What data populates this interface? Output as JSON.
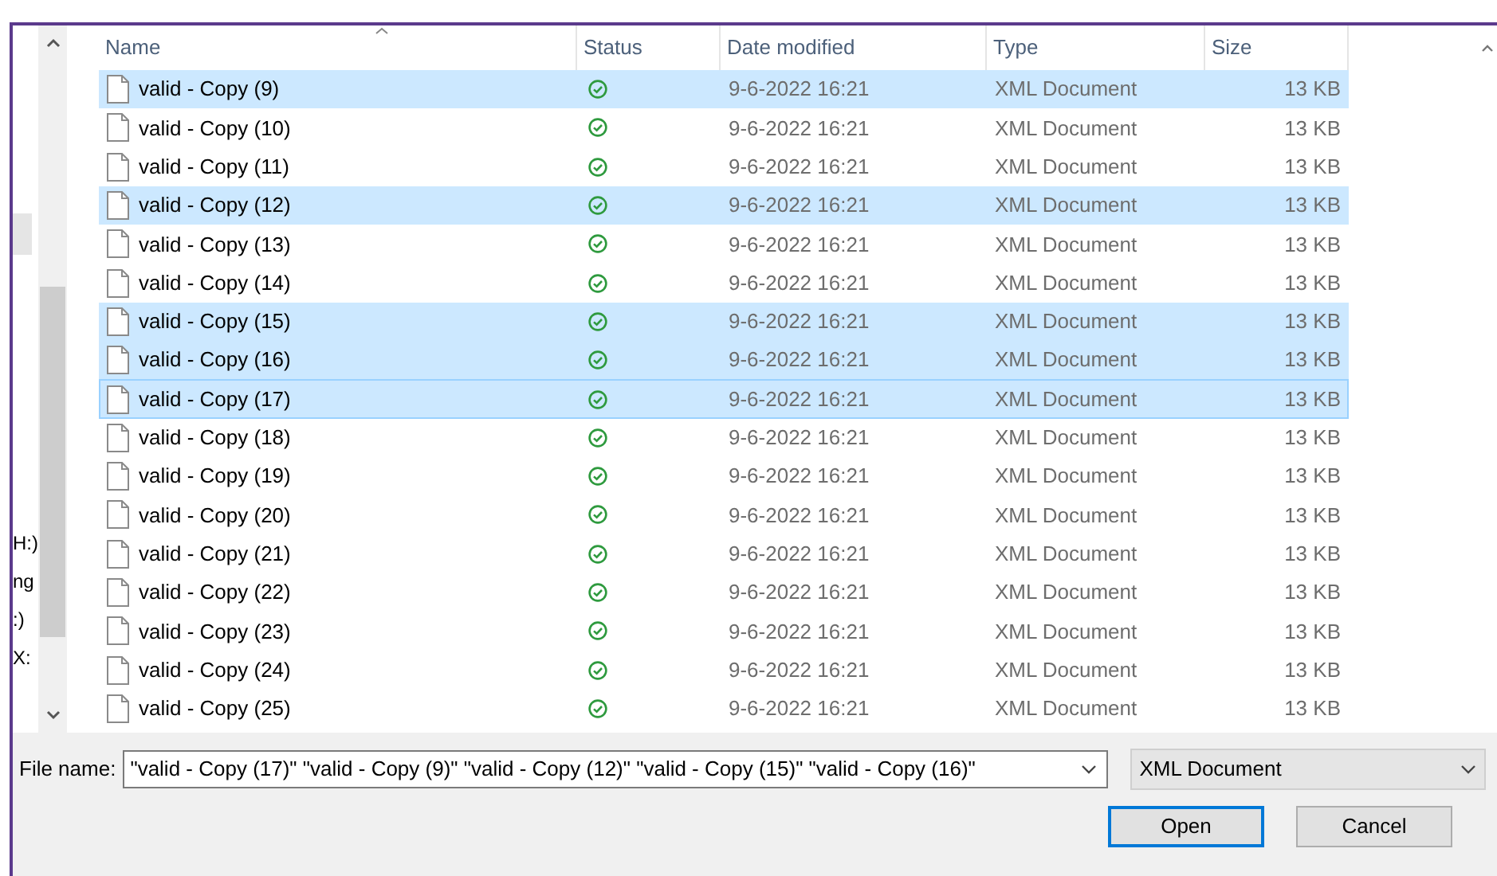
{
  "nav_pane": {
    "items": [
      {
        "label": "H:)"
      },
      {
        "label": "ng"
      },
      {
        "label": ":)"
      },
      {
        "label": "X:"
      }
    ]
  },
  "file_list": {
    "columns": [
      {
        "label": "Name",
        "sorted": true
      },
      {
        "label": "Status",
        "sorted": false
      },
      {
        "label": "Date modified",
        "sorted": false
      },
      {
        "label": "Type",
        "sorted": false
      },
      {
        "label": "Size",
        "sorted": false
      }
    ],
    "rows": [
      {
        "name": "valid - Copy (9)",
        "date": "9-6-2022 16:21",
        "type": "XML Document",
        "size": "13 KB",
        "selected": true,
        "focused": false
      },
      {
        "name": "valid - Copy (10)",
        "date": "9-6-2022 16:21",
        "type": "XML Document",
        "size": "13 KB",
        "selected": false,
        "focused": false
      },
      {
        "name": "valid - Copy (11)",
        "date": "9-6-2022 16:21",
        "type": "XML Document",
        "size": "13 KB",
        "selected": false,
        "focused": false
      },
      {
        "name": "valid - Copy (12)",
        "date": "9-6-2022 16:21",
        "type": "XML Document",
        "size": "13 KB",
        "selected": true,
        "focused": false
      },
      {
        "name": "valid - Copy (13)",
        "date": "9-6-2022 16:21",
        "type": "XML Document",
        "size": "13 KB",
        "selected": false,
        "focused": false
      },
      {
        "name": "valid - Copy (14)",
        "date": "9-6-2022 16:21",
        "type": "XML Document",
        "size": "13 KB",
        "selected": false,
        "focused": false
      },
      {
        "name": "valid - Copy (15)",
        "date": "9-6-2022 16:21",
        "type": "XML Document",
        "size": "13 KB",
        "selected": true,
        "focused": false
      },
      {
        "name": "valid - Copy (16)",
        "date": "9-6-2022 16:21",
        "type": "XML Document",
        "size": "13 KB",
        "selected": true,
        "focused": false
      },
      {
        "name": "valid - Copy (17)",
        "date": "9-6-2022 16:21",
        "type": "XML Document",
        "size": "13 KB",
        "selected": true,
        "focused": true
      },
      {
        "name": "valid - Copy (18)",
        "date": "9-6-2022 16:21",
        "type": "XML Document",
        "size": "13 KB",
        "selected": false,
        "focused": false
      },
      {
        "name": "valid - Copy (19)",
        "date": "9-6-2022 16:21",
        "type": "XML Document",
        "size": "13 KB",
        "selected": false,
        "focused": false
      },
      {
        "name": "valid - Copy (20)",
        "date": "9-6-2022 16:21",
        "type": "XML Document",
        "size": "13 KB",
        "selected": false,
        "focused": false
      },
      {
        "name": "valid - Copy (21)",
        "date": "9-6-2022 16:21",
        "type": "XML Document",
        "size": "13 KB",
        "selected": false,
        "focused": false
      },
      {
        "name": "valid - Copy (22)",
        "date": "9-6-2022 16:21",
        "type": "XML Document",
        "size": "13 KB",
        "selected": false,
        "focused": false
      },
      {
        "name": "valid - Copy (23)",
        "date": "9-6-2022 16:21",
        "type": "XML Document",
        "size": "13 KB",
        "selected": false,
        "focused": false
      },
      {
        "name": "valid - Copy (24)",
        "date": "9-6-2022 16:21",
        "type": "XML Document",
        "size": "13 KB",
        "selected": false,
        "focused": false
      },
      {
        "name": "valid - Copy (25)",
        "date": "9-6-2022 16:21",
        "type": "XML Document",
        "size": "13 KB",
        "selected": false,
        "focused": false
      }
    ]
  },
  "file_name": {
    "label": "File name:",
    "value": "\"valid - Copy (17)\" \"valid - Copy (9)\" \"valid - Copy (12)\" \"valid - Copy (15)\" \"valid - Copy (16)\""
  },
  "file_type": {
    "value": "XML Document"
  },
  "buttons": [
    {
      "label": "Open",
      "default": true
    },
    {
      "label": "Cancel",
      "default": false
    }
  ]
}
